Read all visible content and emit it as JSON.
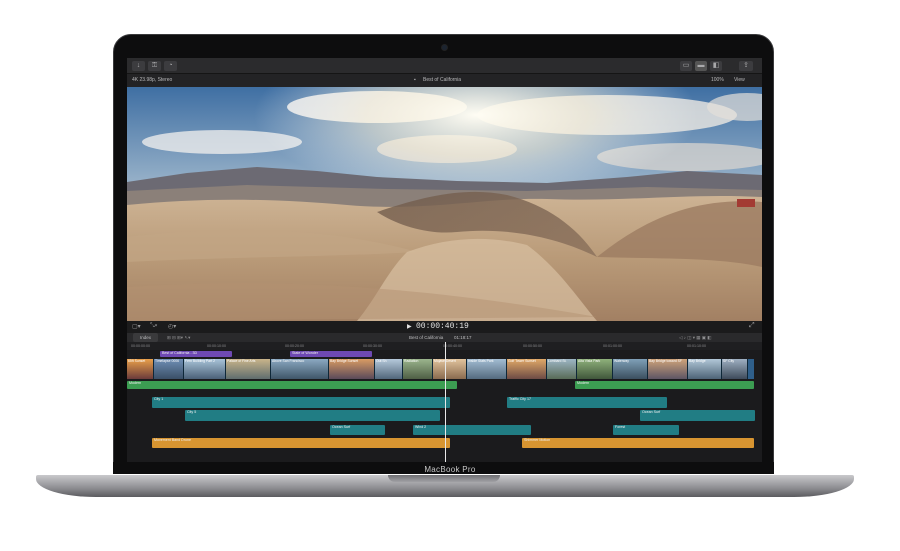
{
  "device": {
    "label": "MacBook Pro"
  },
  "viewer": {
    "format": "4K 23.98p, Stereo",
    "project_title": "Best of California",
    "zoom": "100%",
    "view_menu": "View",
    "timecode": "00:00:40:19"
  },
  "timeline": {
    "index_tab": "Index",
    "project_title": "Best of California",
    "duration": "01:18:17",
    "ruler": [
      "00:00:00:00",
      "00:00:10:00",
      "00:00:20:00",
      "00:00:30:00",
      "00:00:40:00",
      "00:00:50:00",
      "00:01:00:00",
      "00:01:10:00"
    ],
    "titles": [
      "Best of California - 3D",
      "State of Wonder"
    ],
    "primary_clips": [
      "65ft Sunset",
      "Timelapse 0006",
      "Fern Building Part 2",
      "Palace of Fine Arts",
      "Above San Francisco",
      "Bay Bridge Sunset",
      "Out Sh",
      "Radiation",
      "Mojave Desert",
      "Inside Stats Park",
      "Golf Tower Sunset",
      "Lombard St.",
      "Alta Vista Park",
      "Waterway",
      "Bay Bridge toward SF",
      "Bay Bridge",
      "SF City"
    ],
    "music": [
      "Modern",
      "Modern"
    ],
    "connected": [
      "City 1",
      "City 5",
      "Traffic City 17",
      "Ocean Surf",
      "Ocean Surf",
      "Wind 2",
      "Forest"
    ],
    "audio": [
      "Movement Band Drone",
      "Shimmer Motion"
    ]
  },
  "colors": {
    "accent_audio": "#d89531",
    "clip_blue": "#2f5f8a",
    "connected_teal": "#217d84",
    "title_purple": "#6e49b3",
    "music_green": "#3c9d52"
  }
}
